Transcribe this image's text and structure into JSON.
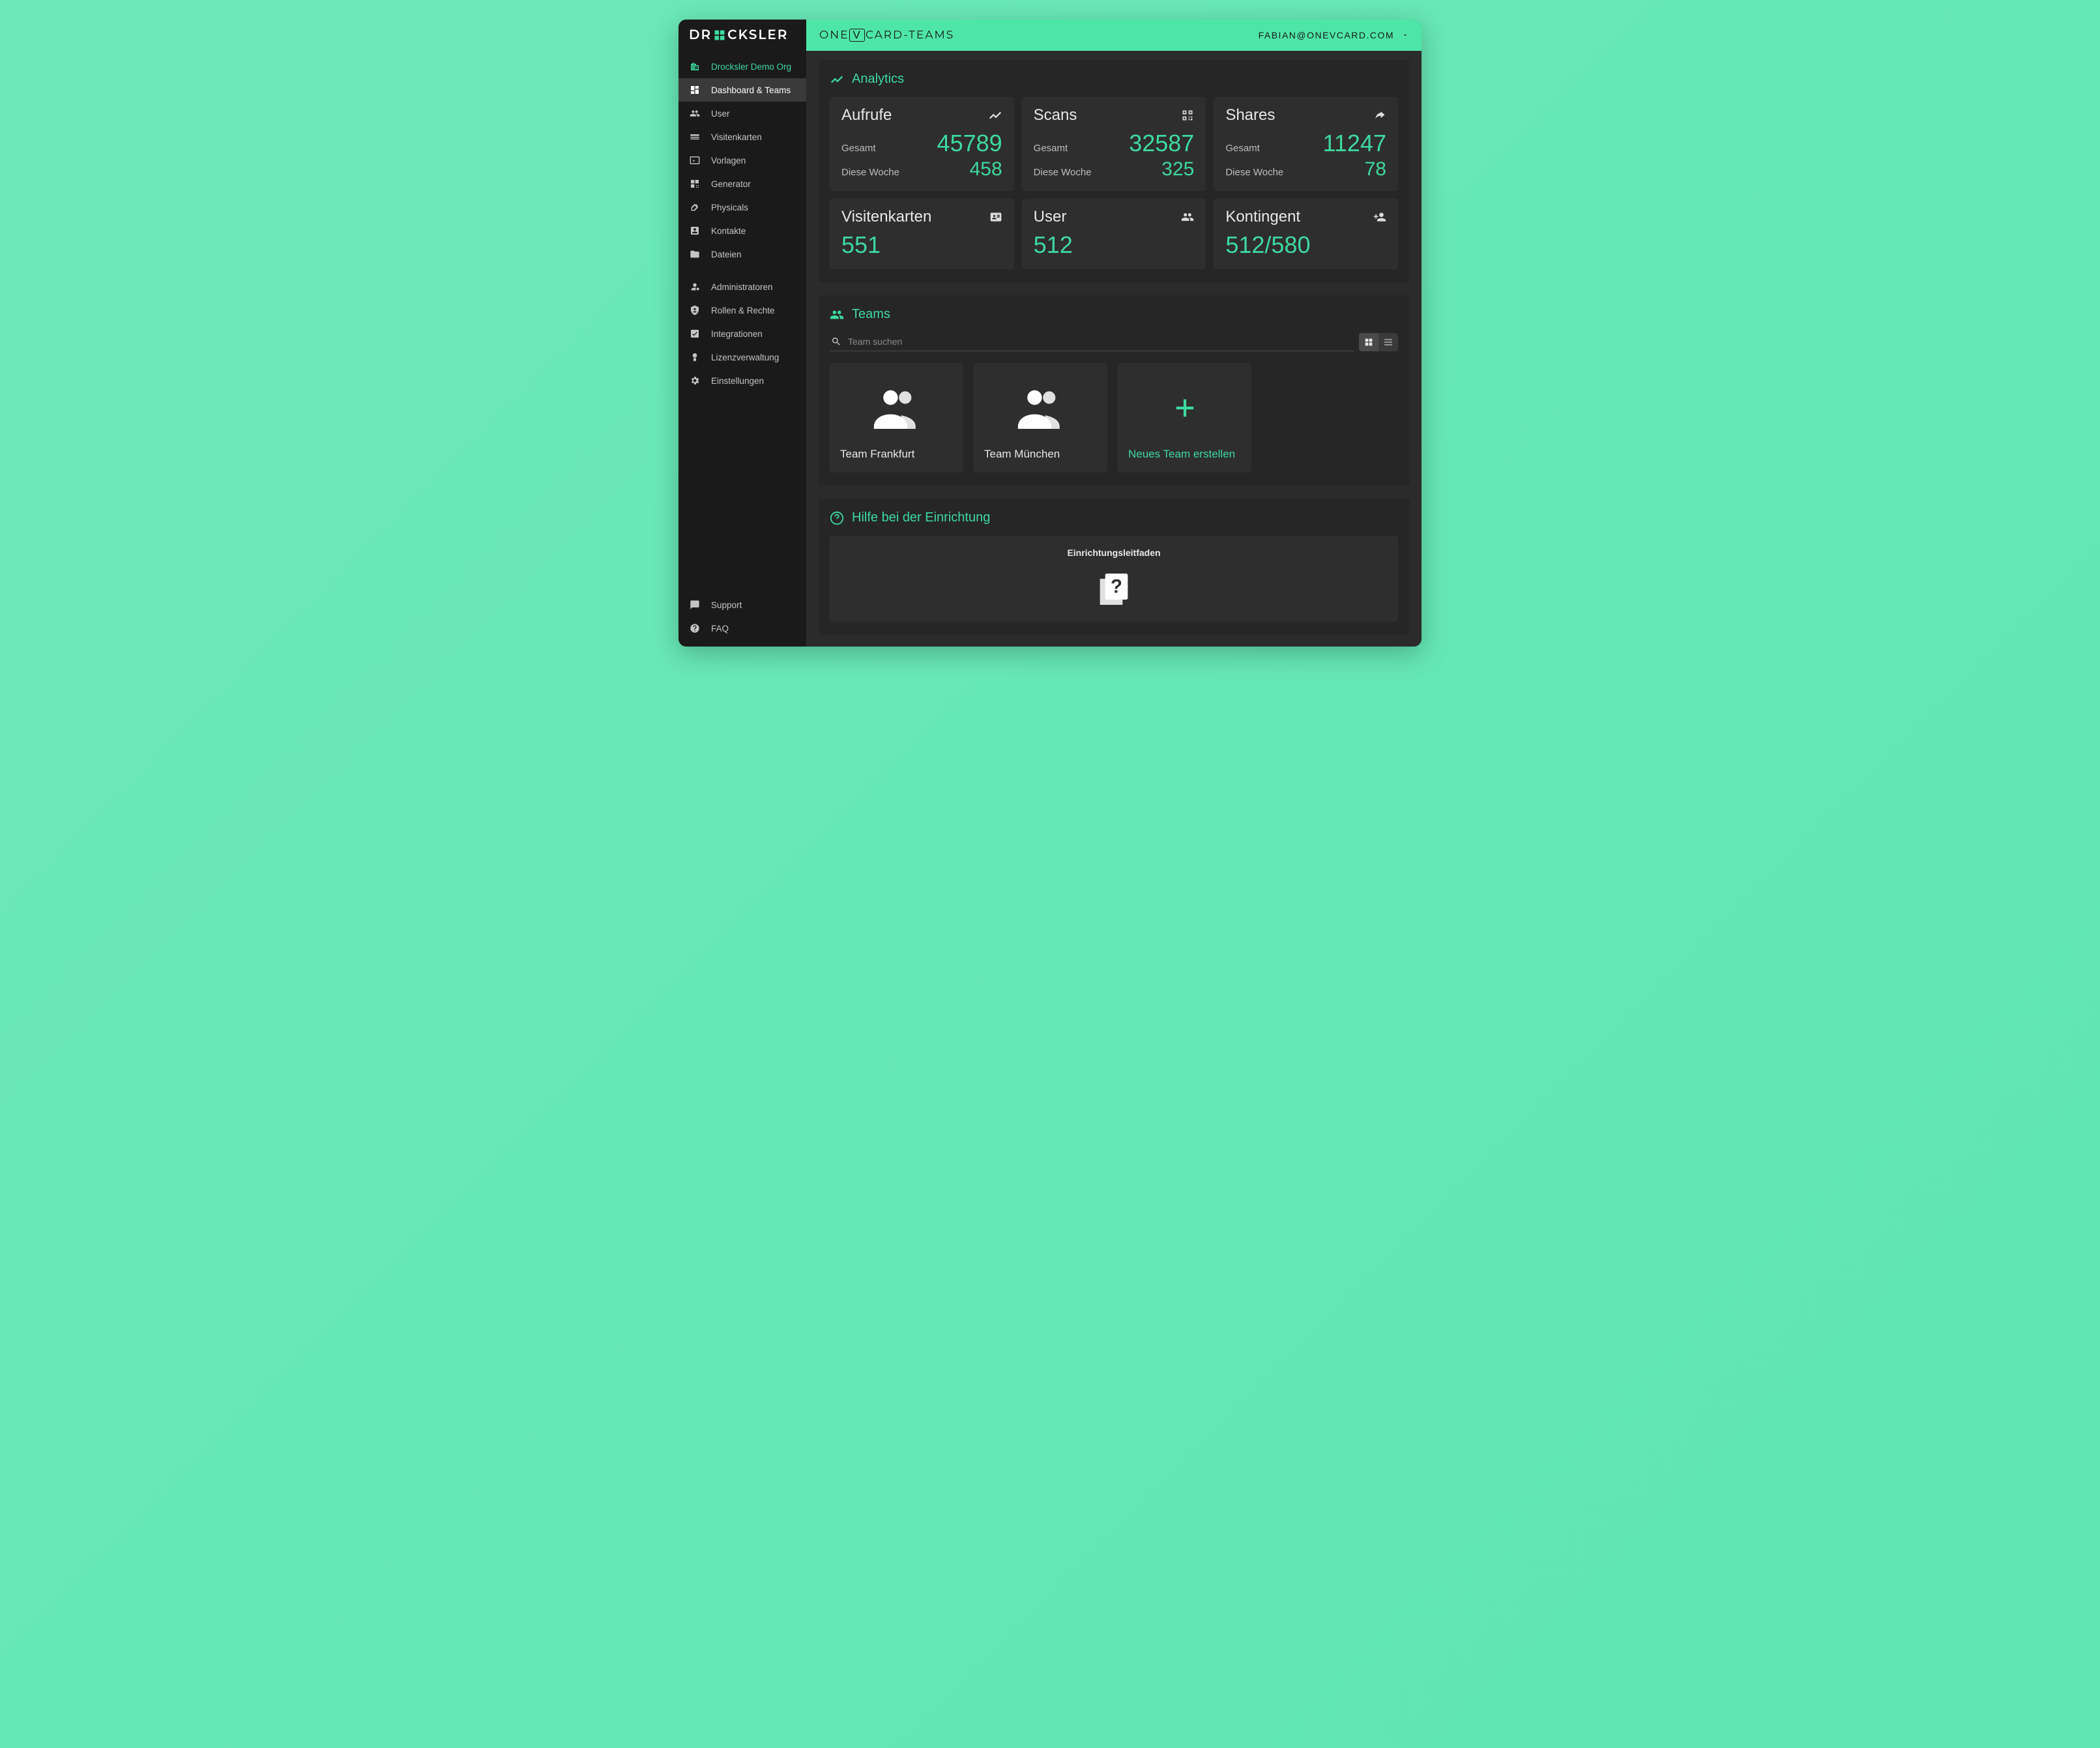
{
  "brand": "DROCKSLER",
  "header": {
    "app_title": "ONEVCARD-TEAMS",
    "user_email": "FABIAN@ONEVCARD.COM"
  },
  "sidebar": {
    "org": "Drocksler Demo Org",
    "items": [
      {
        "label": "Dashboard & Teams"
      },
      {
        "label": "User"
      },
      {
        "label": "Visitenkarten"
      },
      {
        "label": "Vorlagen"
      },
      {
        "label": "Generator"
      },
      {
        "label": "Physicals"
      },
      {
        "label": "Kontakte"
      },
      {
        "label": "Dateien"
      }
    ],
    "admin_items": [
      {
        "label": "Administratoren"
      },
      {
        "label": "Rollen & Rechte"
      },
      {
        "label": "Integrationen"
      },
      {
        "label": "Lizenzverwaltung"
      },
      {
        "label": "Einstellungen"
      }
    ],
    "footer_items": [
      {
        "label": "Support"
      },
      {
        "label": "FAQ"
      }
    ]
  },
  "analytics": {
    "title": "Analytics",
    "labels": {
      "total": "Gesamt",
      "week": "Diese Woche"
    },
    "metrics": [
      {
        "title": "Aufrufe",
        "total": "45789",
        "week": "458"
      },
      {
        "title": "Scans",
        "total": "32587",
        "week": "325"
      },
      {
        "title": "Shares",
        "total": "11247",
        "week": "78"
      }
    ],
    "counts": [
      {
        "title": "Visitenkarten",
        "value": "551"
      },
      {
        "title": "User",
        "value": "512"
      },
      {
        "title": "Kontingent",
        "value": "512/580"
      }
    ]
  },
  "teams": {
    "title": "Teams",
    "search_placeholder": "Team suchen",
    "items": [
      {
        "name": "Team Frankfurt"
      },
      {
        "name": "Team München"
      }
    ],
    "new_label": "Neues Team erstellen"
  },
  "help": {
    "title": "Hilfe bei der Einrichtung",
    "guide": "Einrichtungsleitfaden"
  },
  "colors": {
    "accent": "#3ed9a0"
  }
}
